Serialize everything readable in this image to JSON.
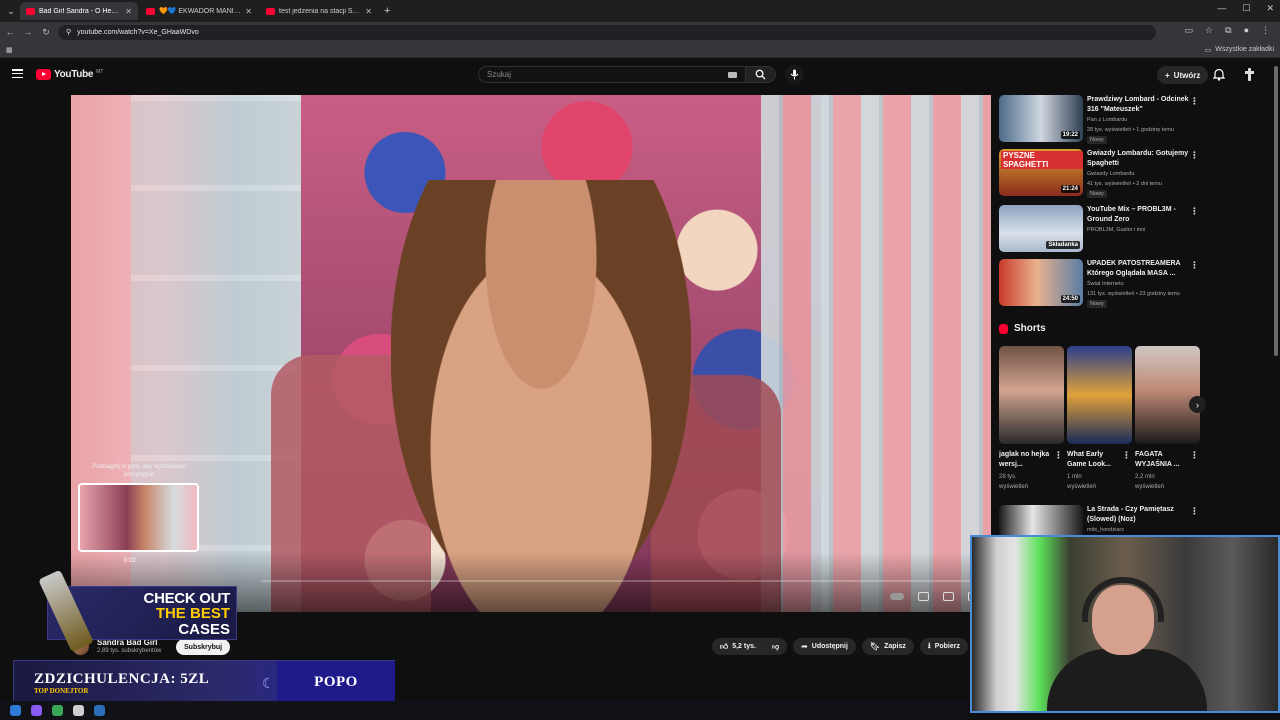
{
  "browser": {
    "tabs": [
      {
        "title": "Bad Girl Sandra - O Hey ! - YouTube",
        "active": true
      },
      {
        "title": "🧡💙 EKWADOR MANIECZKI",
        "active": false
      },
      {
        "title": "test jedzenia na stacji SKOLIM",
        "active": false
      }
    ],
    "url": "youtube.com/watch?v=Xe_GHaaWDvo",
    "bookmarks_all": "Wszystkie zakładki"
  },
  "youtube": {
    "logo": "YouTube",
    "region": "MT",
    "search_placeholder": "Szukaj",
    "create_label": "Utwórz"
  },
  "video": {
    "seek_hint": "Podciągnij w górę, aby wyszukiwać precyzyjnie",
    "seek_time": "0:02",
    "channel_name": "Sandra Bad Girl",
    "channel_subs": "2,89 tys. subskrybentów",
    "subscribe_label": "Subskrybuj",
    "likes": "5,2 tys.",
    "share_label": "Udostępnij",
    "save_label": "Zapisz",
    "download_label": "Pobierz"
  },
  "overlay": {
    "case_ad": [
      "CHECK OUT",
      "THE BEST",
      "CASES"
    ],
    "donation_amount": "ZDZICHULENCJA: 5ZL",
    "donation_sub": "TOP DONEJTOR",
    "donation_name": "POPO"
  },
  "sidebar": {
    "recommendations": [
      {
        "title": "Prawdziwy Lombard - Odcinek 316 \"Mateuszek\"",
        "channel": "Pan z Lombardu",
        "meta": "28 tys. wyświetleń • 1 godzinę temu",
        "duration": "19:22",
        "badge": "Nowy"
      },
      {
        "title": "Gwiazdy Lombardu: Gotujemy Spaghetti",
        "channel": "Gwiazdy Lombardu",
        "meta": "41 tys. wyświetleń • 2 dni temu",
        "duration": "21:24",
        "badge": "Nowy",
        "thumb_text": "PYSZNE SPAGHETTI"
      },
      {
        "title": "YouTube Mix – PROBL3M - Ground Zero",
        "channel": "PROBL3M, Guzior i inni",
        "meta": "",
        "duration": "Składanka",
        "badge": ""
      },
      {
        "title": "UPADEK PATOSTREAMERA Którego Oglądała MASA ...",
        "channel": "Świat Internetu",
        "meta": "131 tys. wyświetleń • 23 godziny temu",
        "duration": "24:50",
        "badge": "Nowy"
      }
    ],
    "shorts_label": "Shorts",
    "shorts": [
      {
        "title": "jaglak no hejka wersj...",
        "views": "28 tys.",
        "views_label": "wyświetleń"
      },
      {
        "title": "What Early Game Look...",
        "views": "1 mln",
        "views_label": "wyświetleń"
      },
      {
        "title": "FAGATA WYJAŚNIA ...",
        "views": "2,2 mln",
        "views_label": "wyświetleń"
      }
    ],
    "next_rec": {
      "title": "La Strada - Czy Pamiętasz (Slowed) (Noz)",
      "channel": "mits_hondziarz"
    }
  }
}
